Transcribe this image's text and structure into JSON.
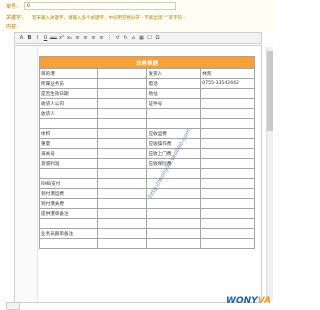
{
  "form": {
    "field1_label": "单号：",
    "field1_value": "0",
    "tags_label": "关键字：",
    "tags_hint": "若未输入关键字，请输入多个关键字，中间用空格分开 - 不能出现“’”等字符 -",
    "content_label": "内容："
  },
  "toolbar": {
    "buttons": [
      "A",
      "B",
      "I",
      "U",
      "ABC",
      "x²",
      "x₂",
      "≡",
      "≡",
      "≡",
      "≡",
      "⋮",
      "↺",
      "↻",
      "⌂",
      "▦",
      "☐",
      "Ω"
    ]
  },
  "table": {
    "title": "业务单据",
    "rows": [
      [
        "目的港",
        "",
        "发货人",
        "林凯"
      ],
      [
        "所属业务员",
        "",
        "电话",
        "0755-33542642"
      ],
      [
        "是否生效日期",
        "",
        "地址",
        ""
      ],
      [
        "收货人公司",
        "",
        "证件号",
        ""
      ],
      [
        "收货人",
        "",
        "",
        ""
      ],
      [
        "",
        "",
        "",
        ""
      ],
      [
        "体积",
        "",
        "应收运费",
        ""
      ],
      [
        "重量",
        "",
        "应收操作费",
        ""
      ],
      [
        "海关号",
        "",
        "应收上门费",
        ""
      ],
      [
        "货值利润",
        "",
        "应收保险费",
        ""
      ],
      [
        "",
        "",
        "",
        ""
      ],
      [
        "RMB支付",
        "",
        "",
        ""
      ],
      [
        "到付港运费",
        "",
        "",
        ""
      ],
      [
        "到付港关费",
        "",
        "",
        ""
      ],
      [
        "提供港单备注",
        "",
        "",
        ""
      ],
      [
        "",
        "",
        "",
        ""
      ],
      [
        "业务员跟单备注",
        "",
        "",
        ""
      ],
      [
        "",
        "",
        "",
        ""
      ]
    ]
  },
  "watermark": "http://wonyva.taobao.com",
  "logo": {
    "main": "WONY",
    "accent": "VA"
  },
  "colors": {
    "title_bg": "#f6a03a",
    "border": "#a5a5a5",
    "accent": "#1b5fae"
  }
}
